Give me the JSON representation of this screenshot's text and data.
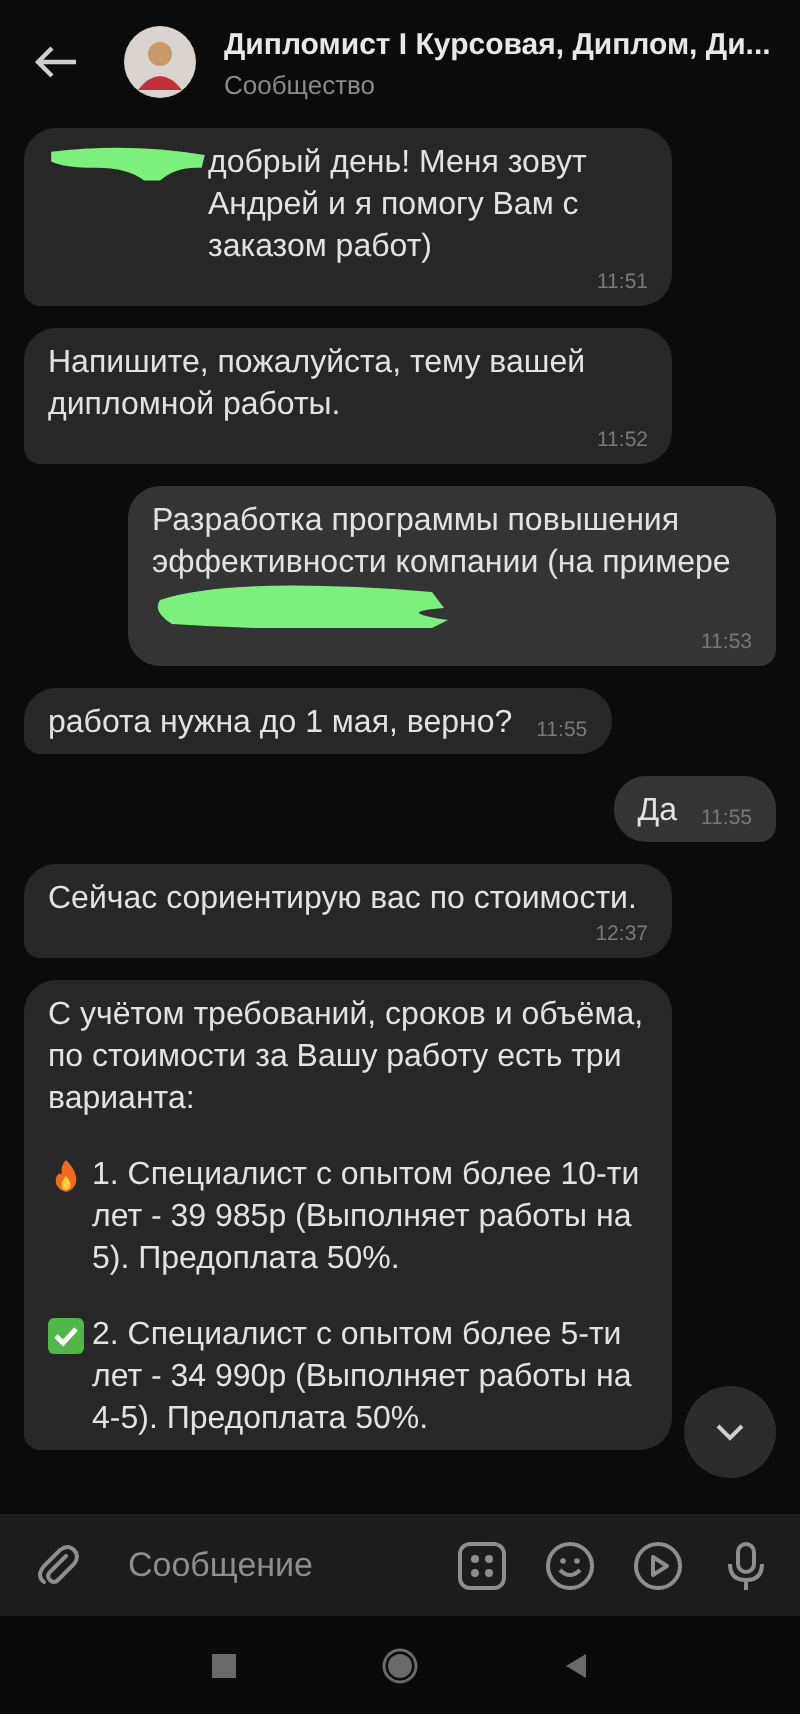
{
  "header": {
    "title": "Дипломист I Курсовая, Диплом, Ди...",
    "subtitle": "Сообщество"
  },
  "messages": [
    {
      "outgoing": false,
      "time": "11:51",
      "paragraphs": [
        {
          "kind": "redacted_before",
          "text": "добрый день! Меня зовут Андрей и я помогу Вам с заказом работ)"
        }
      ]
    },
    {
      "outgoing": false,
      "time": "11:52",
      "paragraphs": [
        {
          "kind": "text",
          "text": "Напишите, пожалуйста, тему вашей дипломной работы."
        }
      ]
    },
    {
      "outgoing": true,
      "time": "11:53",
      "paragraphs": [
        {
          "kind": "redacted_after",
          "text": "Разработка программы повышения эффективности компании (на примере"
        }
      ]
    },
    {
      "outgoing": false,
      "time": "11:55",
      "paragraphs": [
        {
          "kind": "text",
          "text": "работа нужна до 1 мая, верно?"
        }
      ]
    },
    {
      "outgoing": true,
      "time": "11:55",
      "paragraphs": [
        {
          "kind": "text",
          "text": "Да"
        }
      ]
    },
    {
      "outgoing": false,
      "time": "12:37",
      "paragraphs": [
        {
          "kind": "text",
          "text": "Сейчас сориентирую вас по стоимости."
        }
      ]
    },
    {
      "outgoing": false,
      "paragraphs": [
        {
          "kind": "text",
          "text": "С учётом требований, сроков и объёма, по стоимости за Вашу работу есть три варианта:"
        },
        {
          "kind": "fire",
          "text": "1. Специалист с опытом более 10-ти лет - 39 985р (Выполняет работы на 5). Предоплата 50%."
        },
        {
          "kind": "check",
          "text": "2. Специалист с опытом более 5-ти лет - 34 990р (Выполняет работы на 4-5). Предоплата 50%."
        }
      ]
    }
  ],
  "composer": {
    "placeholder": "Сообщение"
  }
}
